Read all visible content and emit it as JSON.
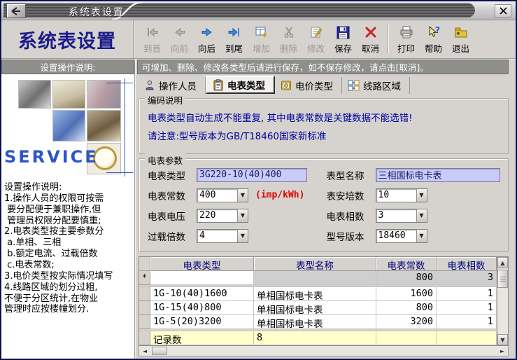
{
  "window": {
    "title": "系统表设置"
  },
  "header": {
    "title": "系统表设置"
  },
  "toolbar": {
    "items": [
      {
        "label": "到首",
        "icon": "first-record-icon",
        "enabled": false
      },
      {
        "label": "向前",
        "icon": "previous-record-icon",
        "enabled": false
      },
      {
        "label": "向后",
        "icon": "next-record-icon",
        "enabled": true
      },
      {
        "label": "到尾",
        "icon": "last-record-icon",
        "enabled": true
      },
      {
        "label": "增加",
        "icon": "add-record-icon",
        "enabled": false
      },
      {
        "label": "删除",
        "icon": "delete-record-icon",
        "enabled": false
      },
      {
        "label": "修改",
        "icon": "modify-record-icon",
        "enabled": false
      },
      {
        "label": "保存",
        "icon": "save-icon",
        "enabled": true
      },
      {
        "label": "取消",
        "icon": "cancel-icon",
        "enabled": true
      },
      {
        "label": "打印",
        "icon": "print-icon",
        "enabled": true
      },
      {
        "label": "帮助",
        "icon": "help-icon",
        "enabled": true
      },
      {
        "label": "退出",
        "icon": "exit-icon",
        "enabled": true
      }
    ]
  },
  "sidebar": {
    "header": "设置操作说明:",
    "service_label": "SERVICE",
    "instructions": "设置操作说明:\n1.操作人员的权限可按需\n 要分配便于兼职操作,但\n 管理员权限分配要慎重;\n2.电表类型按主要参数分\n a.单相、三相\n b.额定电流、过载倍数\n c.电表常数;\n3.电价类型按实际情况填写\n4.线路区域的划分过粗,\n不便于分区统计,在物业\n管理时应按楼幢划分."
  },
  "main": {
    "notice": "可增加、删除、修改各类型后请进行保存，如不保存修改，请点击[取消]。",
    "tabs": [
      {
        "label": "操作人员",
        "icon": "operator-icon",
        "active": false
      },
      {
        "label": "电表类型",
        "icon": "meter-type-icon",
        "active": true
      },
      {
        "label": "电价类型",
        "icon": "price-type-icon",
        "active": false
      },
      {
        "label": "线路区域",
        "icon": "line-area-icon",
        "active": false
      }
    ],
    "coding": {
      "title": "编码说明",
      "line1": "电表类型自动生成不能重复, 其中电表常数是关键数据不能选错!",
      "line2": "请注意:型号版本为GB/T18460国家新标准"
    },
    "params": {
      "title": "电表参数",
      "fields": [
        {
          "label": "电表类型",
          "value": "3G220-10(40)400",
          "control": "text"
        },
        {
          "label": "表型名称",
          "value": "三相国标电卡表",
          "control": "text"
        },
        {
          "label": "电表常数",
          "value": "400",
          "control": "select",
          "suffix": "(imp/kWh)"
        },
        {
          "label": "表安培数",
          "value": "10",
          "control": "select"
        },
        {
          "label": "电表电压",
          "value": "220",
          "control": "select"
        },
        {
          "label": "电表相数",
          "value": "3",
          "control": "select"
        },
        {
          "label": "过载倍数",
          "value": "4",
          "control": "select"
        },
        {
          "label": "型号版本",
          "value": "18460",
          "control": "select"
        }
      ]
    },
    "grid": {
      "columns": [
        "电表类型",
        "表型名称",
        "电表常数",
        "电表相数"
      ],
      "new_row": {
        "marker": "*",
        "meter_type": "",
        "model_name": "",
        "constant": "800",
        "phases": "3"
      },
      "rows": [
        {
          "meter_type": "1G-10(40)1600",
          "model_name": "单相国标电卡表",
          "constant": "1600",
          "phases": "1"
        },
        {
          "meter_type": "1G-15(40)800",
          "model_name": "单相国标电卡表",
          "constant": "800",
          "phases": "1"
        },
        {
          "meter_type": "1G-5(20)3200",
          "model_name": "单相国标电卡表",
          "constant": "3200",
          "phases": "1"
        }
      ],
      "footer": {
        "label": "记录数",
        "value": "8"
      }
    }
  },
  "colors": {
    "accent_navy": "#1b1b8a",
    "info_navy": "#0000a0",
    "field_lavender": "#c9ccf8",
    "notice_gray": "#8e8e8a",
    "footer_yellow": "#ffffcc",
    "alert_red": "#e00000"
  }
}
